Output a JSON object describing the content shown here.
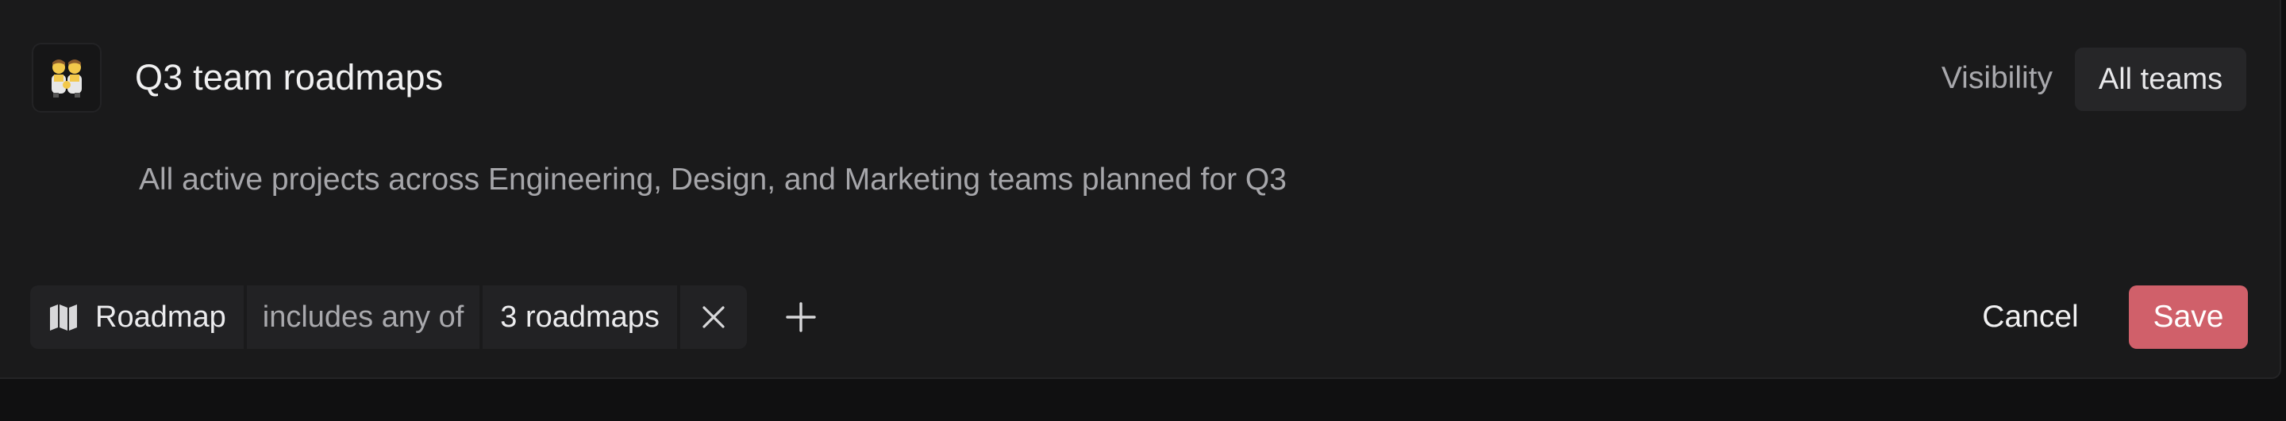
{
  "header": {
    "icon": "people-holding-hands-emoji",
    "title": "Q3 team roadmaps",
    "visibility_label": "Visibility",
    "visibility_value": "All teams"
  },
  "description": "All active projects across Engineering, Design, and Marketing teams planned for Q3",
  "filter": {
    "field_icon": "map-icon",
    "field": "Roadmap",
    "operator": "includes any of",
    "value": "3 roadmaps",
    "remove_icon": "close-icon",
    "add_icon": "plus-icon"
  },
  "actions": {
    "cancel_label": "Cancel",
    "save_label": "Save"
  },
  "colors": {
    "background": "#101011",
    "panel": "#1a1a1b",
    "chip": "#222224",
    "save_button": "#d0606a"
  }
}
